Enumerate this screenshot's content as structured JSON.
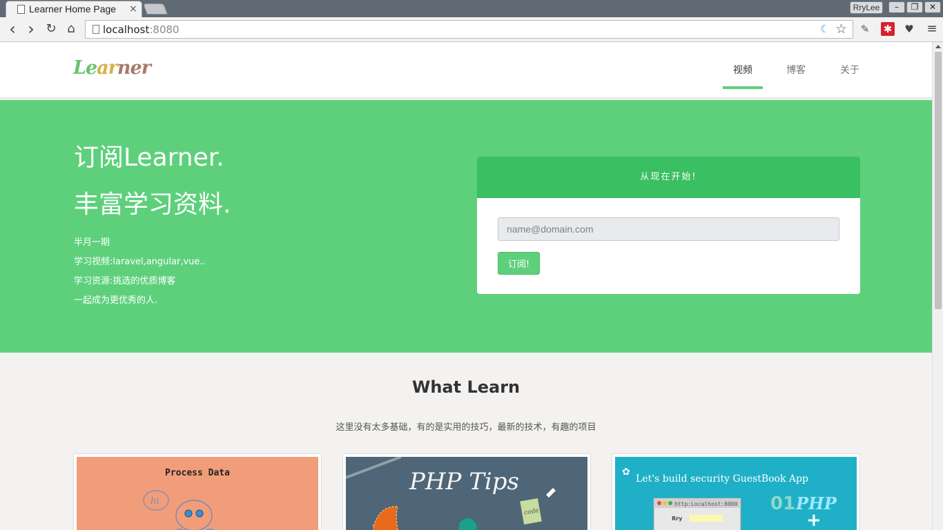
{
  "browser": {
    "tab_title": "Learner Home Page",
    "tab_close": "×",
    "user_badge": "RryLee",
    "window_buttons": {
      "minimize": "–",
      "restore": "❐",
      "close": "✕"
    },
    "nav": {
      "back": "‹",
      "forward": "›",
      "reload": "↻",
      "home": "⌂"
    },
    "url_host": "localhost",
    "url_port": ":8080",
    "menu_glyph": "≡"
  },
  "site": {
    "logo": {
      "part1": "Le",
      "part2": "ar",
      "part3": "ner"
    },
    "nav": [
      {
        "label": "视频",
        "active": true
      },
      {
        "label": "博客",
        "active": false
      },
      {
        "label": "关于",
        "active": false
      }
    ],
    "accent_color": "#5ed07c"
  },
  "hero": {
    "headline1": "订阅Learner.",
    "headline2": "丰富学习资料.",
    "lines": [
      "半月一期",
      "学习视频:laravel,angular,vue..",
      "学习资源:挑选的优质博客",
      "一起成为更优秀的人."
    ],
    "subscribe": {
      "heading": "从现在开始!",
      "placeholder": "name@domain.com",
      "button": "订阅!"
    }
  },
  "content": {
    "title": "What Learn",
    "subtitle": "这里没有太多基础，有的是实用的技巧，最新的技术，有趣的项目",
    "cards": [
      {
        "label": "Process Data"
      },
      {
        "label": "PHP Tips"
      },
      {
        "label": "Let's build security GuestBook App"
      }
    ]
  }
}
